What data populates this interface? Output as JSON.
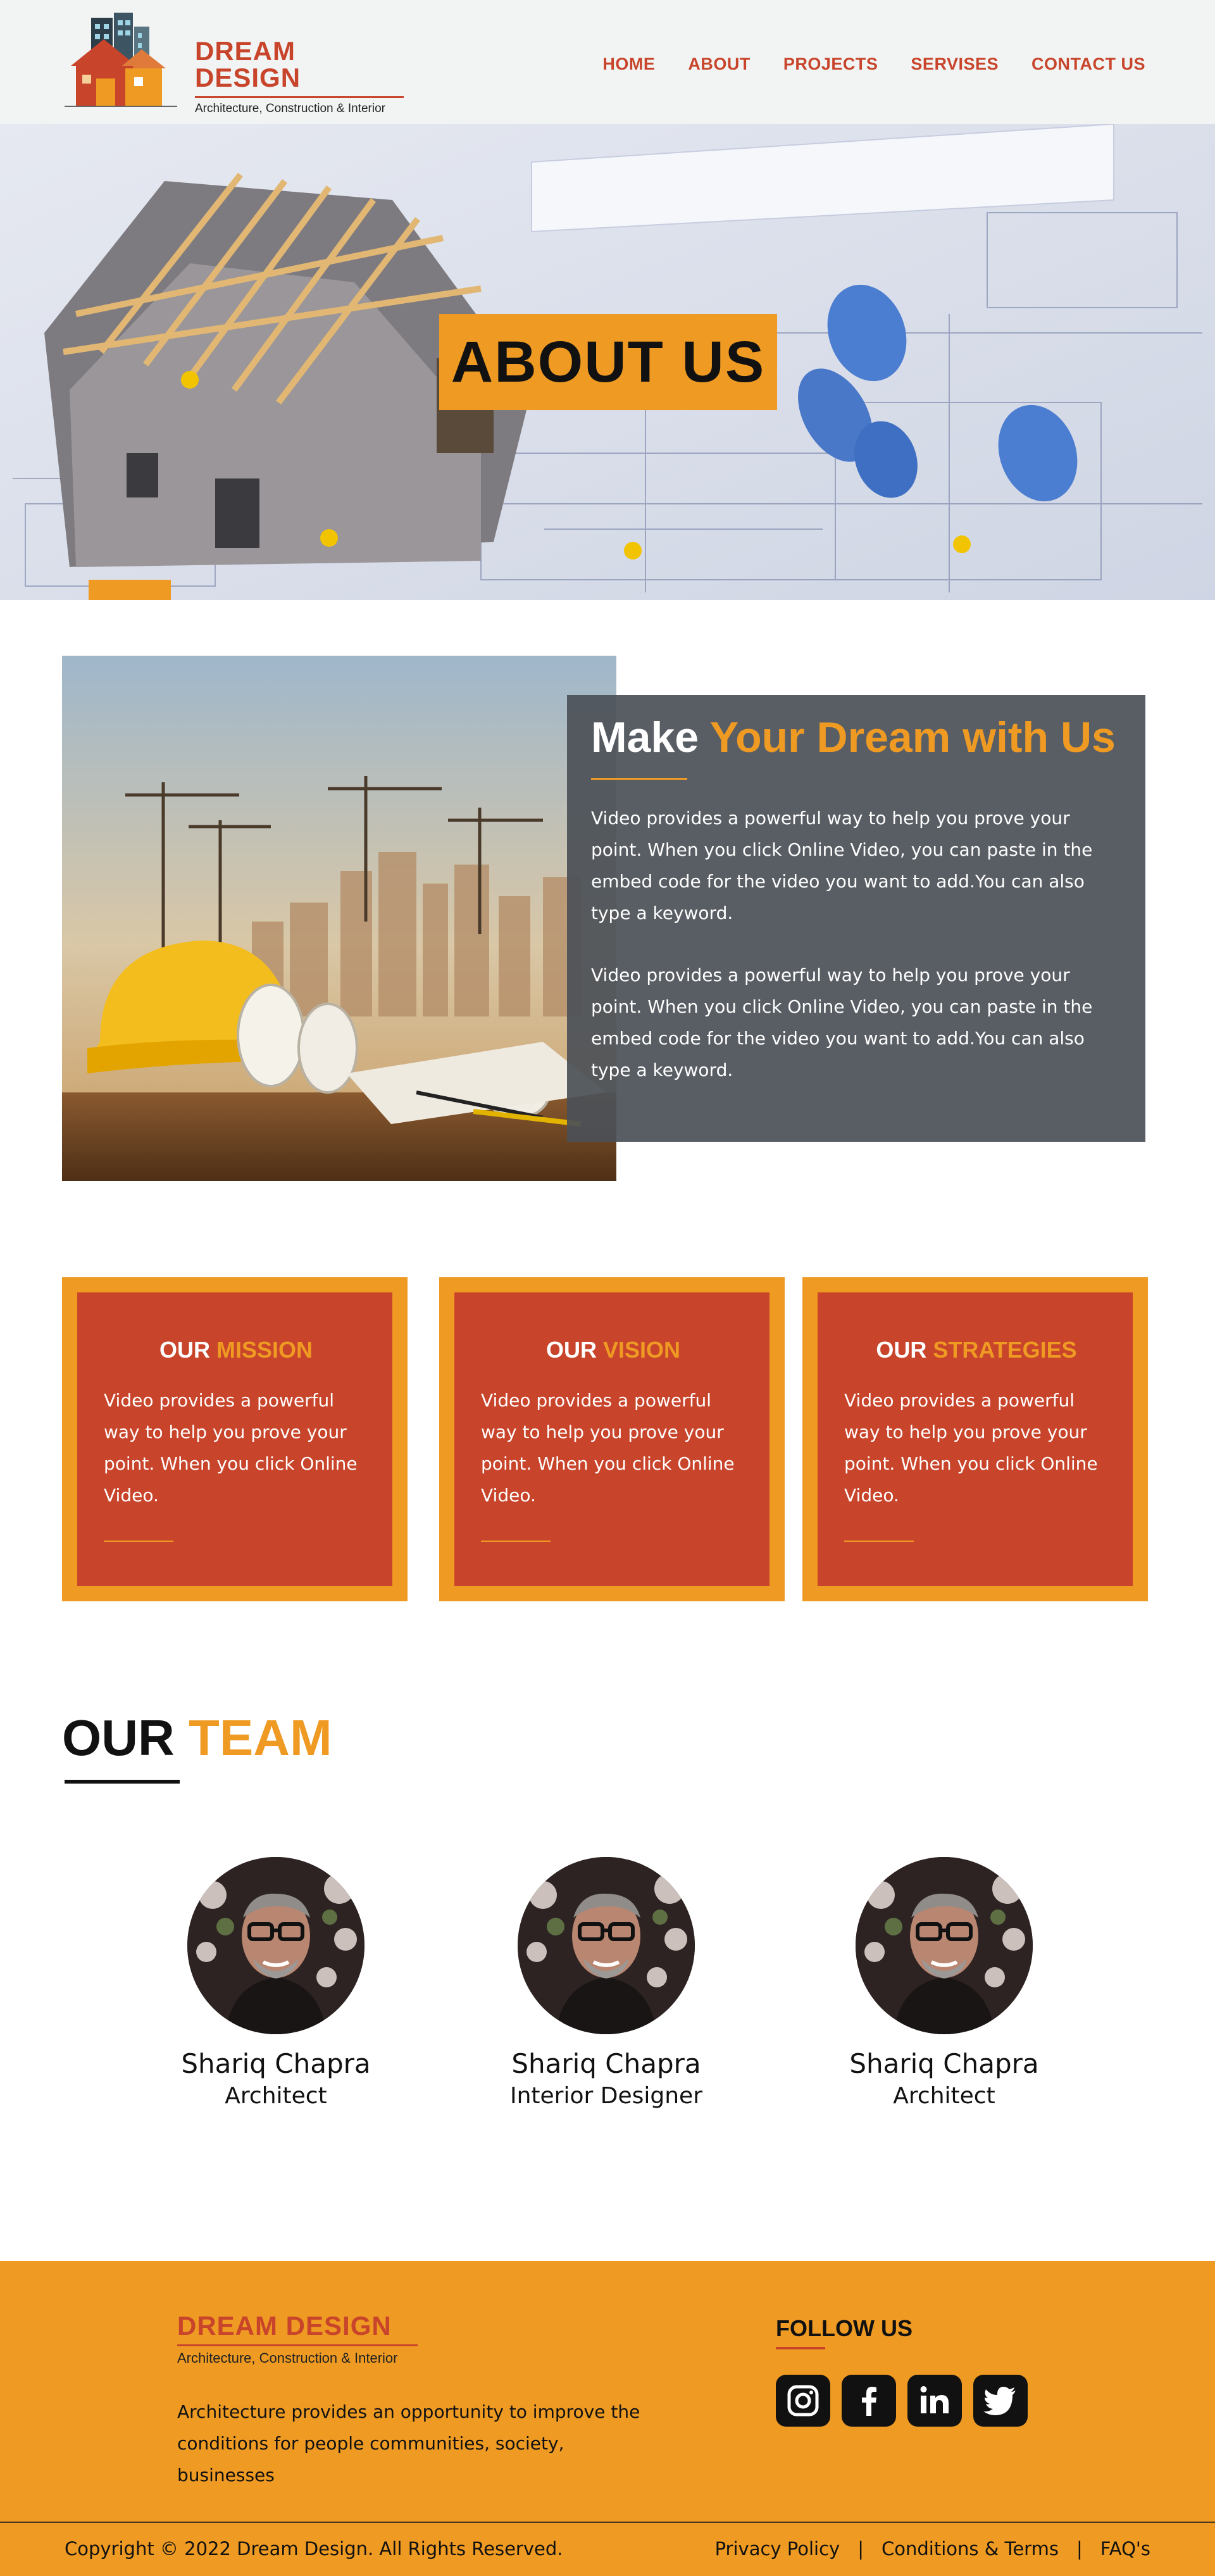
{
  "brand": {
    "title": "DREAM DESIGN",
    "subtitle": "Architecture, Construction & Interior"
  },
  "nav": {
    "items": [
      "HOME",
      "ABOUT",
      "PROJECTS",
      "SERVISES",
      "CONTACT US"
    ]
  },
  "hero": {
    "title": "ABOUT US"
  },
  "about": {
    "title_plain": "Make",
    "title_highlight": "Your Dream with Us",
    "paragraphs": [
      "Video provides a powerful way to help you prove your point. When you click Online Video, you can paste in the embed code for the video you want to add.You can also type a keyword.",
      "Video provides a powerful way to help you prove your point. When you click Online Video, you can paste in the embed code for the video you want to add.You can also type a keyword."
    ]
  },
  "cards": [
    {
      "prefix": "OUR",
      "highlight": "MISSION",
      "text": "Video provides a powerful way to help you prove your point. When you click Online Video."
    },
    {
      "prefix": "OUR",
      "highlight": "VISION",
      "text": "Video provides a powerful way to help you prove your point. When you click Online Video."
    },
    {
      "prefix": "OUR",
      "highlight": "STRATEGIES",
      "text": "Video provides a powerful way to help you prove your point. When you click Online Video."
    }
  ],
  "team": {
    "title_plain": "OUR",
    "title_highlight": "TEAM",
    "members": [
      {
        "name": "Shariq Chapra",
        "role": "Architect"
      },
      {
        "name": "Shariq Chapra",
        "role": "Interior Designer"
      },
      {
        "name": "Shariq Chapra",
        "role": "Architect"
      }
    ]
  },
  "footer": {
    "brand_title": "DREAM DESIGN",
    "brand_subtitle": "Architecture, Construction & Interior",
    "about": "Architecture provides an opportunity to improve the conditions for people communities, society, businesses",
    "follow_label": "FOLLOW US",
    "socials": [
      "instagram-icon",
      "facebook-icon",
      "linkedin-icon",
      "twitter-icon"
    ],
    "copyright": "Copyright © 2022 Dream Design. All Rights Reserved.",
    "links": [
      "Privacy Policy",
      "Conditions & Terms",
      "FAQ's"
    ],
    "separator": "|"
  },
  "colors": {
    "brand_red": "#c8442a",
    "accent_orange": "#ee9a23",
    "overlay_gray": "#4b5057",
    "header_bg": "#f1f4f3"
  }
}
